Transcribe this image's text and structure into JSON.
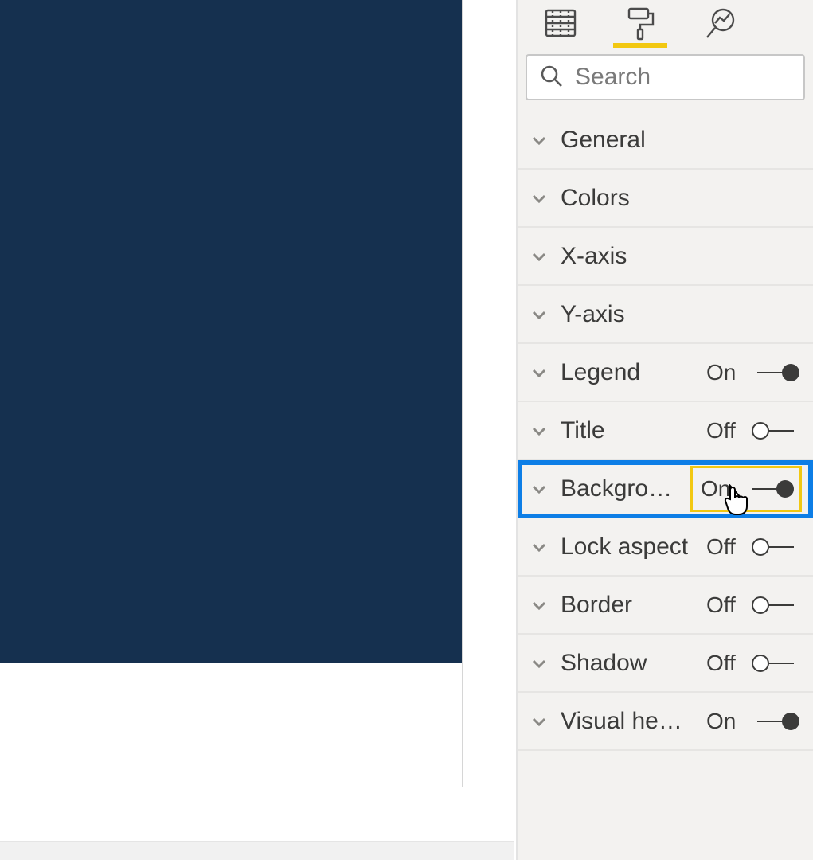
{
  "search": {
    "placeholder": "Search"
  },
  "toggle_text": {
    "on": "On",
    "off": "Off"
  },
  "sections": [
    {
      "label": "General",
      "toggle": null
    },
    {
      "label": "Colors",
      "toggle": null
    },
    {
      "label": "X-axis",
      "toggle": null
    },
    {
      "label": "Y-axis",
      "toggle": null
    },
    {
      "label": "Legend",
      "toggle": "on"
    },
    {
      "label": "Title",
      "toggle": "off"
    },
    {
      "label": "Background",
      "toggle": "on",
      "highlight": true,
      "toggle_highlight": true
    },
    {
      "label": "Lock aspect",
      "toggle": "off"
    },
    {
      "label": "Border",
      "toggle": "off"
    },
    {
      "label": "Shadow",
      "toggle": "off"
    },
    {
      "label": "Visual header",
      "toggle": "on"
    }
  ]
}
